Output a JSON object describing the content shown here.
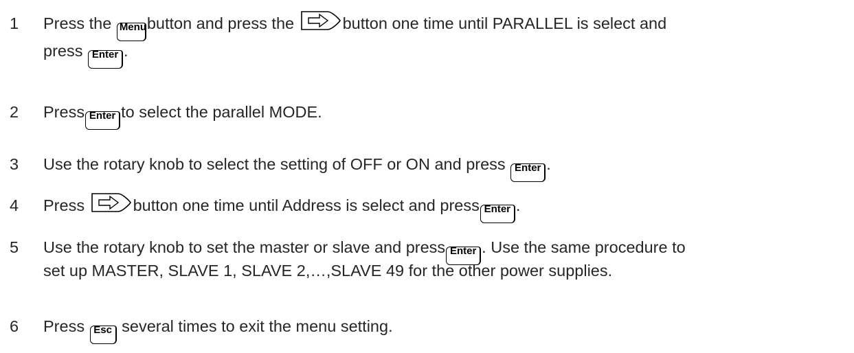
{
  "steps": [
    {
      "number": "1",
      "line1_a": "Press the",
      "key_menu": "Menu",
      "line1_b": "button and press the",
      "line1_c": "button one time until PARALLEL is select and",
      "line2_a": "press",
      "key_enter": "Enter",
      "line2_b": "."
    },
    {
      "number": "2",
      "text_a": "Press",
      "key_enter": "Enter",
      "text_b": "to select the parallel MODE."
    },
    {
      "number": "3",
      "text_a": "Use the rotary knob to select the setting of OFF or ON and press",
      "key_enter": "Enter",
      "text_b": "."
    },
    {
      "number": "4",
      "text_a": "Press",
      "text_b": "button one time until Address is select and press",
      "key_enter": "Enter",
      "text_c": "."
    },
    {
      "number": "5",
      "line1_a": "Use the rotary knob to set the master or slave and press",
      "key_enter": "Enter",
      "line1_b": ". Use the same procedure to",
      "line2": "set up MASTER, SLAVE 1, SLAVE 2,…,SLAVE 49 for the other power supplies."
    },
    {
      "number": "6",
      "text_a": "Press",
      "key_esc": "Esc",
      "text_b": "several times to exit the menu setting."
    }
  ],
  "icons": {
    "arrow_key": "right-arrow-key-icon"
  }
}
